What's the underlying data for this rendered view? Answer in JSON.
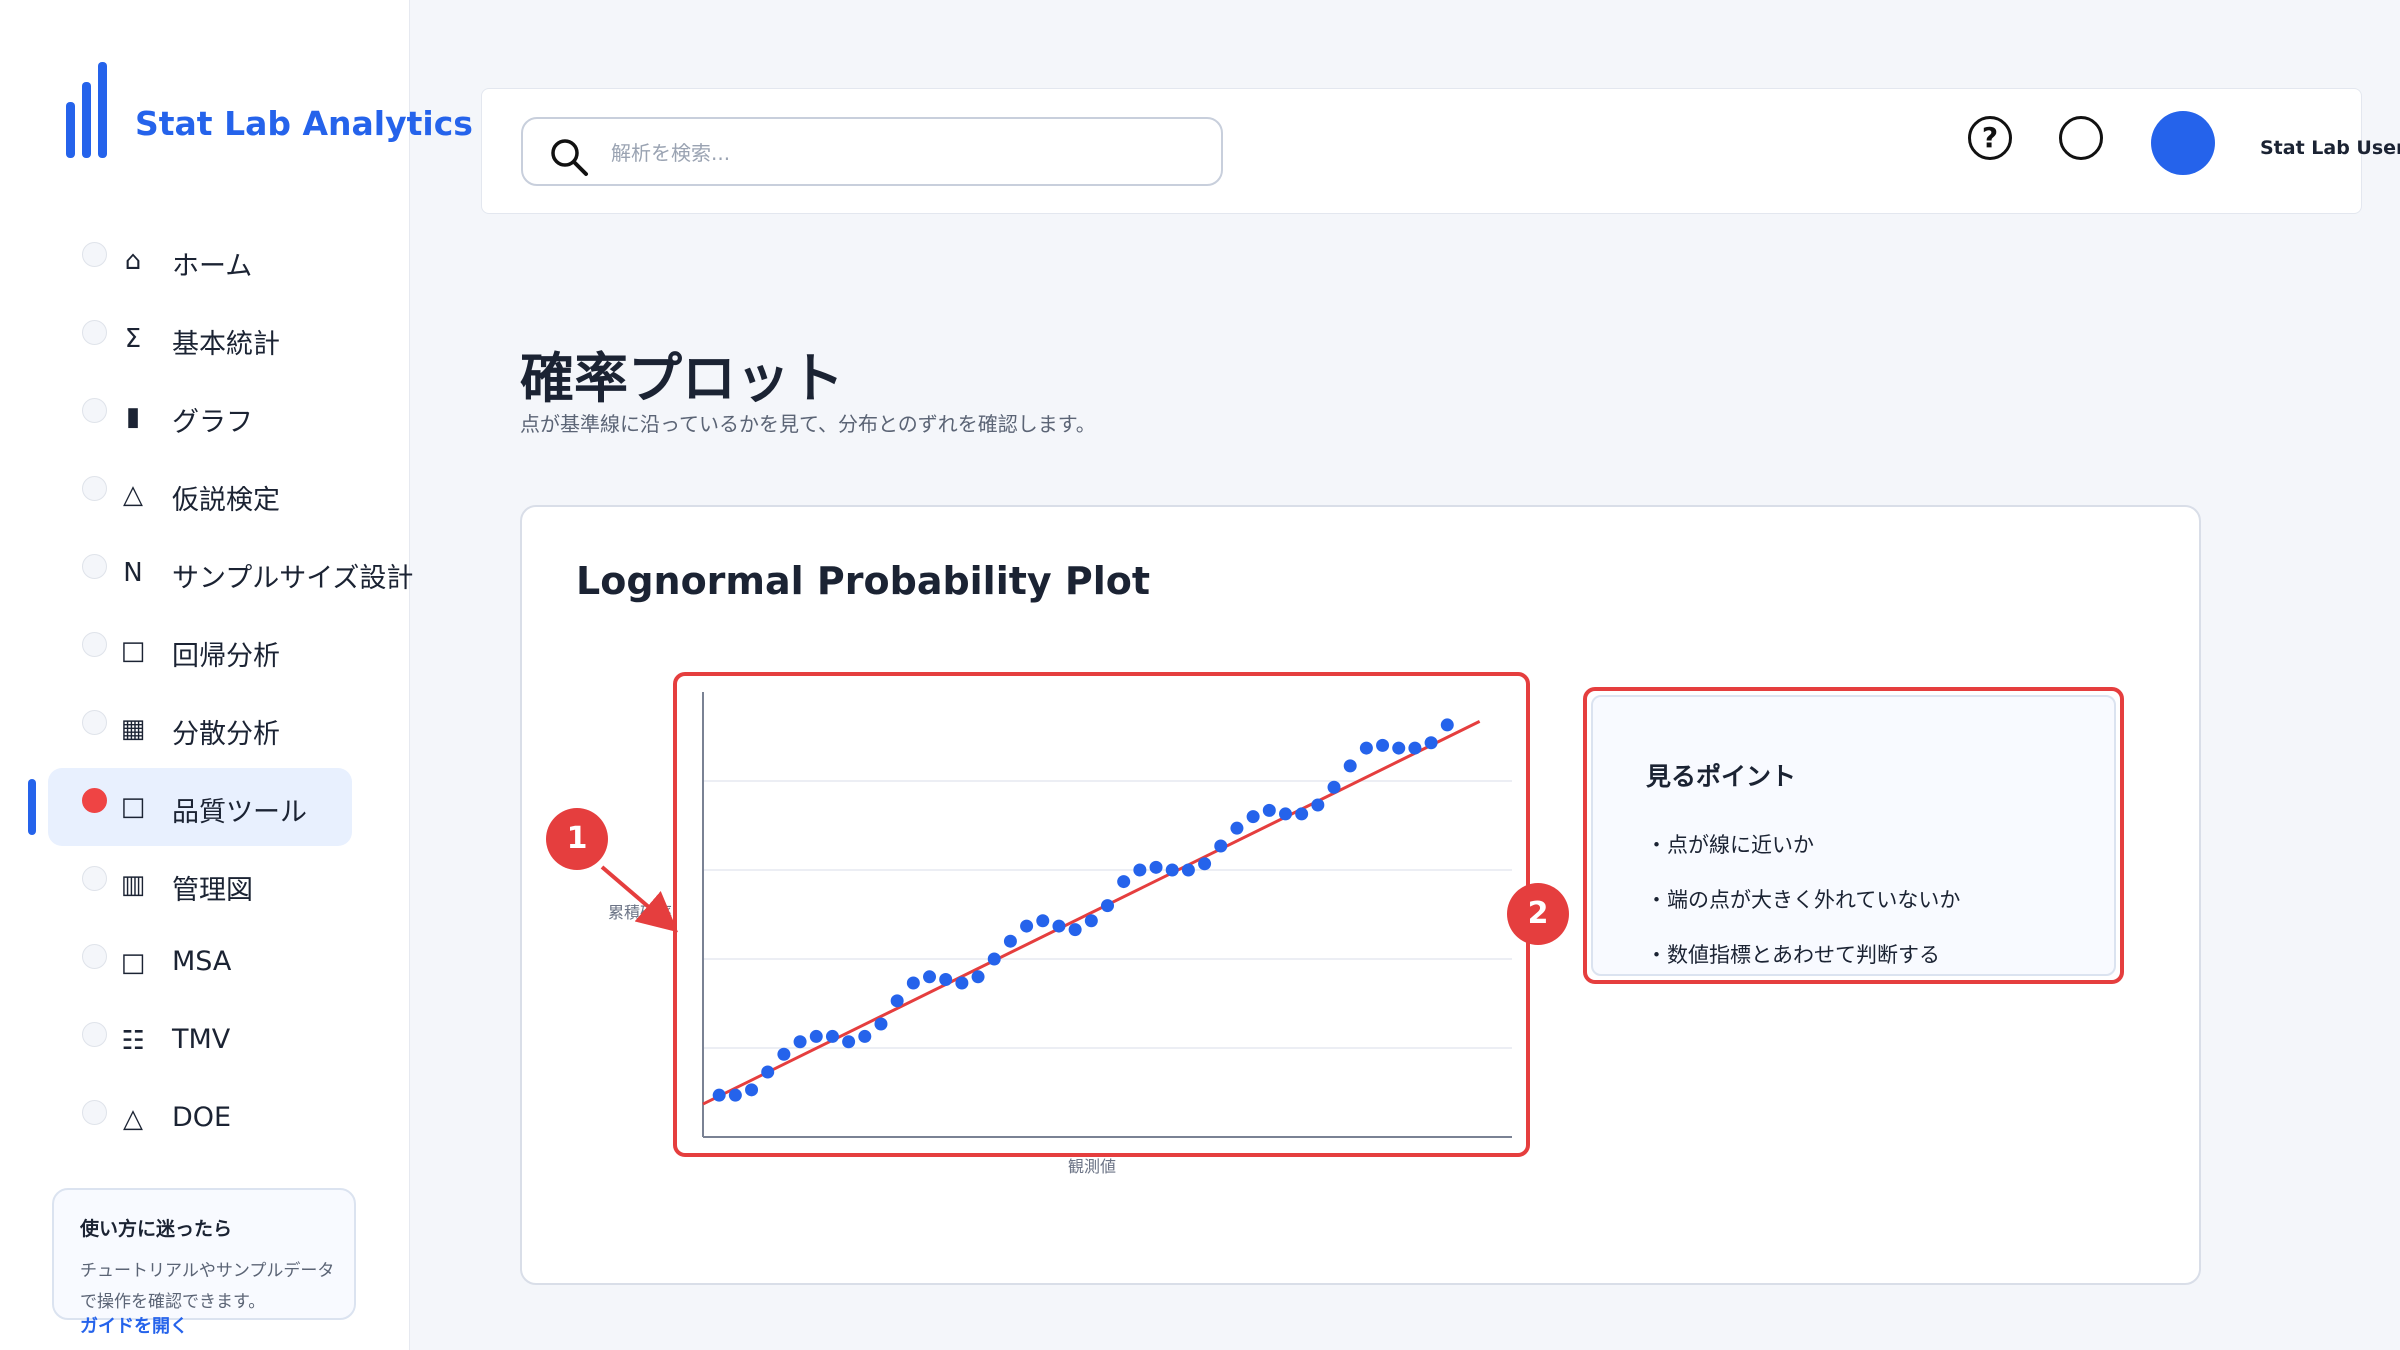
{
  "brand": {
    "title": "Stat Lab Analytics",
    "accent": "#2563eb"
  },
  "sidebar": {
    "items": [
      {
        "icon": "home-icon",
        "glyph": "⌂",
        "label": "ホーム"
      },
      {
        "icon": "sigma-icon",
        "glyph": "Σ",
        "label": "基本統計"
      },
      {
        "icon": "bar-chart-icon",
        "glyph": "▮",
        "label": "グラフ"
      },
      {
        "icon": "triangle-icon",
        "glyph": "△",
        "label": "仮説検定"
      },
      {
        "icon": "n-icon",
        "glyph": "N",
        "label": "サンプルサイズ設計"
      },
      {
        "icon": "square-icon",
        "glyph": "□",
        "label": "回帰分析"
      },
      {
        "icon": "grid-icon",
        "glyph": "▦",
        "label": "分散分析"
      },
      {
        "icon": "square-icon",
        "glyph": "□",
        "label": "品質ツール",
        "active": true
      },
      {
        "icon": "columns-icon",
        "glyph": "▥",
        "label": "管理図"
      },
      {
        "icon": "square-icon",
        "glyph": "□",
        "label": "MSA"
      },
      {
        "icon": "list-icon",
        "glyph": "☷",
        "label": "TMV"
      },
      {
        "icon": "triangle-icon",
        "glyph": "△",
        "label": "DOE"
      }
    ],
    "help": {
      "title": "使い方に迷ったら",
      "body": "チュートリアルやサンプルデータで操作を確認できます。",
      "link": "ガイドを開く"
    }
  },
  "topbar": {
    "search_placeholder": "解析を検索...",
    "help_glyph": "?",
    "username": "Stat Lab User"
  },
  "page": {
    "title": "確率プロット",
    "subtitle": "点が基準線に沿っているかを見て、分布とのずれを確認します。"
  },
  "card": {
    "title": "Lognormal Probability Plot",
    "badge_1": "1",
    "badge_2": "2"
  },
  "chart_data": {
    "type": "scatter",
    "title": "Lognormal Probability Plot",
    "xlabel": "観測値",
    "ylabel": "累積確率",
    "grid": true,
    "xlim": [
      0,
      50
    ],
    "ylim": [
      0,
      5
    ],
    "points": [
      [
        1,
        0.47
      ],
      [
        2,
        0.47
      ],
      [
        3,
        0.53
      ],
      [
        4,
        0.73
      ],
      [
        5,
        0.93
      ],
      [
        6,
        1.07
      ],
      [
        7,
        1.13
      ],
      [
        8,
        1.13
      ],
      [
        9,
        1.07
      ],
      [
        10,
        1.13
      ],
      [
        11,
        1.27
      ],
      [
        12,
        1.53
      ],
      [
        13,
        1.73
      ],
      [
        14,
        1.8
      ],
      [
        15,
        1.77
      ],
      [
        16,
        1.73
      ],
      [
        17,
        1.8
      ],
      [
        18,
        2.0
      ],
      [
        19,
        2.2
      ],
      [
        20,
        2.37
      ],
      [
        21,
        2.43
      ],
      [
        22,
        2.37
      ],
      [
        23,
        2.33
      ],
      [
        24,
        2.43
      ],
      [
        25,
        2.6
      ],
      [
        26,
        2.87
      ],
      [
        27,
        3.0
      ],
      [
        28,
        3.03
      ],
      [
        29,
        3.0
      ],
      [
        30,
        3.0
      ],
      [
        31,
        3.07
      ],
      [
        32,
        3.27
      ],
      [
        33,
        3.47
      ],
      [
        34,
        3.6
      ],
      [
        35,
        3.67
      ],
      [
        36,
        3.63
      ],
      [
        37,
        3.63
      ],
      [
        38,
        3.73
      ],
      [
        39,
        3.93
      ],
      [
        40,
        4.17
      ],
      [
        41,
        4.37
      ],
      [
        42,
        4.4
      ],
      [
        43,
        4.37
      ],
      [
        44,
        4.37
      ],
      [
        45,
        4.43
      ],
      [
        46,
        4.63
      ]
    ],
    "reference_line": {
      "x": [
        0,
        48
      ],
      "y": [
        0.37,
        4.67
      ]
    },
    "point_color": "#2563eb",
    "line_color": "#e53e3e"
  },
  "tips": {
    "title": "見るポイント",
    "items": [
      "・点が線に近いか",
      "・端の点が大きく外れていないか",
      "・数値指標とあわせて判断する"
    ]
  }
}
